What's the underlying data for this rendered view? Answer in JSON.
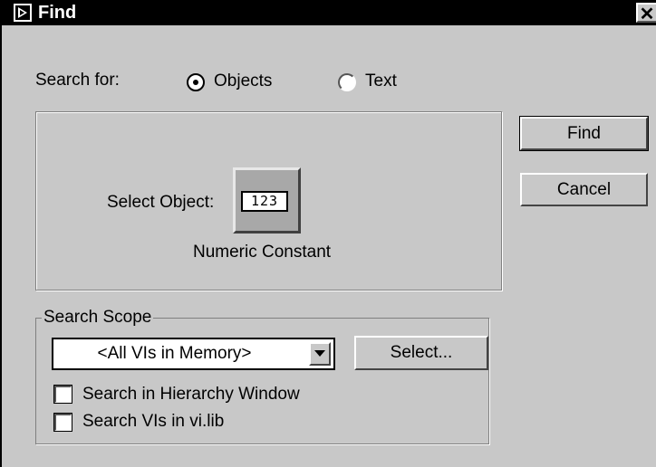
{
  "window": {
    "title": "Find",
    "close_label": "✕",
    "close_icon": "close-icon",
    "app_icon": "find-app-icon"
  },
  "search_for": {
    "label": "Search for:",
    "options": [
      {
        "label": "Objects",
        "selected": true
      },
      {
        "label": "Text",
        "selected": false
      }
    ]
  },
  "object_panel": {
    "select_label": "Select Object:",
    "numeric_value": "123",
    "object_name": "Numeric Constant"
  },
  "buttons": {
    "find": "Find",
    "cancel": "Cancel",
    "select": "Select..."
  },
  "scope": {
    "title": "Search Scope",
    "dropdown_value": "<All VIs in Memory>",
    "checkboxes": [
      {
        "label": "Search in Hierarchy Window",
        "checked": false
      },
      {
        "label": "Search VIs in vi.lib",
        "checked": false
      }
    ]
  }
}
